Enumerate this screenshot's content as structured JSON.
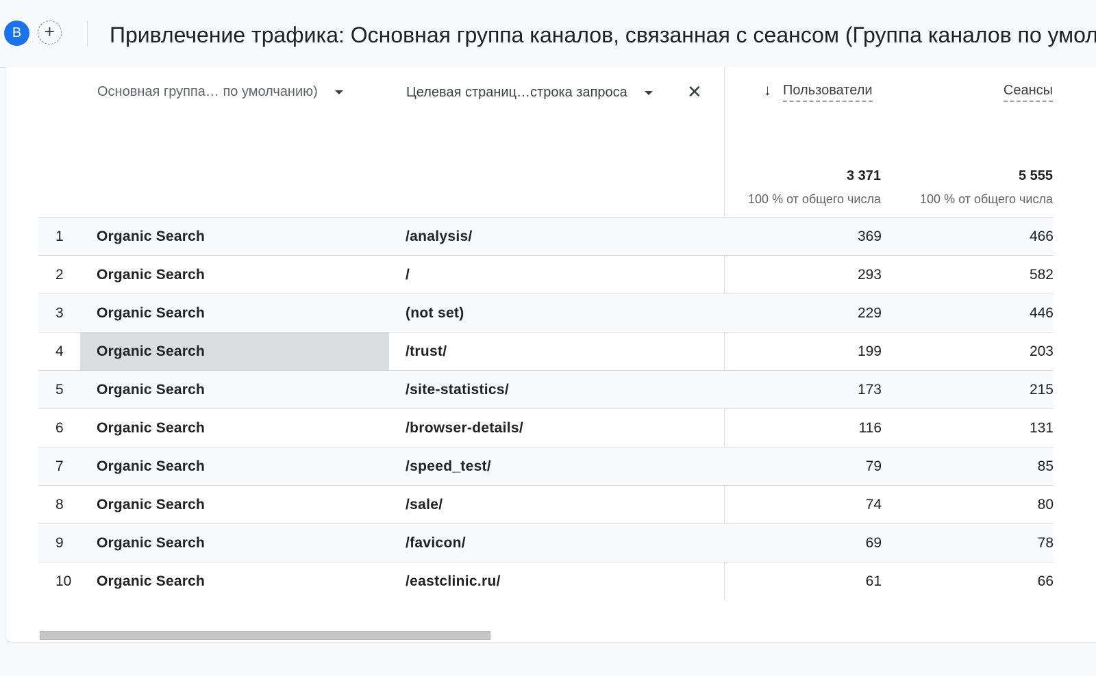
{
  "header": {
    "avatar_letter": "B",
    "add_button": "+",
    "title": "Привлечение трафика: Основная группа каналов, связанная с сеансом (Группа каналов по умолчанию)"
  },
  "table": {
    "dimension1_header": "Основная группа… по умолчанию)",
    "dimension2_header": "Целевая страниц…строка запроса",
    "remove_dimension_icon": "close-icon",
    "sort_icon": "arrow-down-icon",
    "metric1_header": "Пользователи",
    "metric2_header": "Сеансы",
    "totals": {
      "users": "3 371",
      "users_sub": "100 % от общего числа",
      "sessions": "5 555",
      "sessions_sub": "100 % от общего числа"
    },
    "rows": [
      {
        "idx": "1",
        "channel": "Organic Search",
        "page": "/analysis/",
        "users": "369",
        "sessions": "466"
      },
      {
        "idx": "2",
        "channel": "Organic Search",
        "page": "/",
        "users": "293",
        "sessions": "582"
      },
      {
        "idx": "3",
        "channel": "Organic Search",
        "page": "(not set)",
        "users": "229",
        "sessions": "446"
      },
      {
        "idx": "4",
        "channel": "Organic Search",
        "page": "/trust/",
        "users": "199",
        "sessions": "203"
      },
      {
        "idx": "5",
        "channel": "Organic Search",
        "page": "/site-statistics/",
        "users": "173",
        "sessions": "215"
      },
      {
        "idx": "6",
        "channel": "Organic Search",
        "page": "/browser-details/",
        "users": "116",
        "sessions": "131"
      },
      {
        "idx": "7",
        "channel": "Organic Search",
        "page": "/speed_test/",
        "users": "79",
        "sessions": "85"
      },
      {
        "idx": "8",
        "channel": "Organic Search",
        "page": "/sale/",
        "users": "74",
        "sessions": "80"
      },
      {
        "idx": "9",
        "channel": "Organic Search",
        "page": "/favicon/",
        "users": "69",
        "sessions": "78"
      },
      {
        "idx": "10",
        "channel": "Organic Search",
        "page": "/eastclinic.ru/",
        "users": "61",
        "sessions": "66"
      }
    ],
    "highlighted_row": 4
  },
  "colors": {
    "accent": "#1a73e8",
    "row_alt": "#f8f9fa",
    "highlight": "#dadce0",
    "divider": "#dadce0"
  }
}
